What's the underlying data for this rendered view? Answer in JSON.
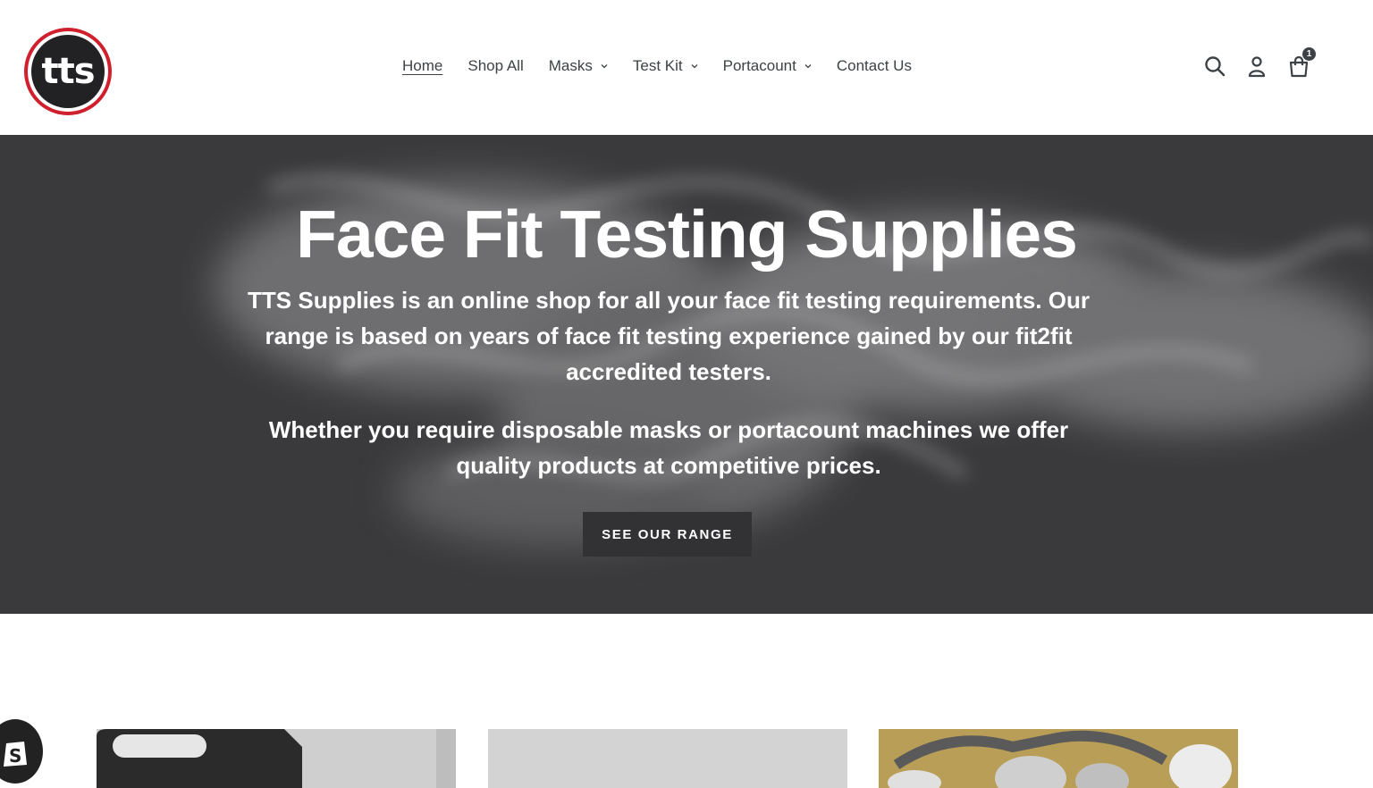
{
  "logo": {
    "text": "tts",
    "ring_color": "#d0202e"
  },
  "nav": {
    "items": [
      {
        "label": "Home",
        "active": true,
        "dropdown": false
      },
      {
        "label": "Shop All",
        "active": false,
        "dropdown": false
      },
      {
        "label": "Masks",
        "active": false,
        "dropdown": true
      },
      {
        "label": "Test Kit",
        "active": false,
        "dropdown": true
      },
      {
        "label": "Portacount",
        "active": false,
        "dropdown": true
      },
      {
        "label": "Contact Us",
        "active": false,
        "dropdown": false
      }
    ]
  },
  "header_icons": {
    "search": "search-icon",
    "account": "account-icon",
    "cart": "cart-icon",
    "cart_count": "1"
  },
  "hero": {
    "title": "Face Fit Testing Supplies",
    "paragraph1": "TTS Supplies is an online shop for all your face fit testing requirements. Our range is based on years of face fit testing experience gained by our fit2fit accredited testers.",
    "paragraph2": "Whether you require disposable masks or portacount machines we offer quality products at competitive prices.",
    "button_label": "SEE OUR RANGE"
  },
  "colors": {
    "text": "#3d4246",
    "hero_bg": "#3a3a3c",
    "accent": "#d0202e"
  }
}
